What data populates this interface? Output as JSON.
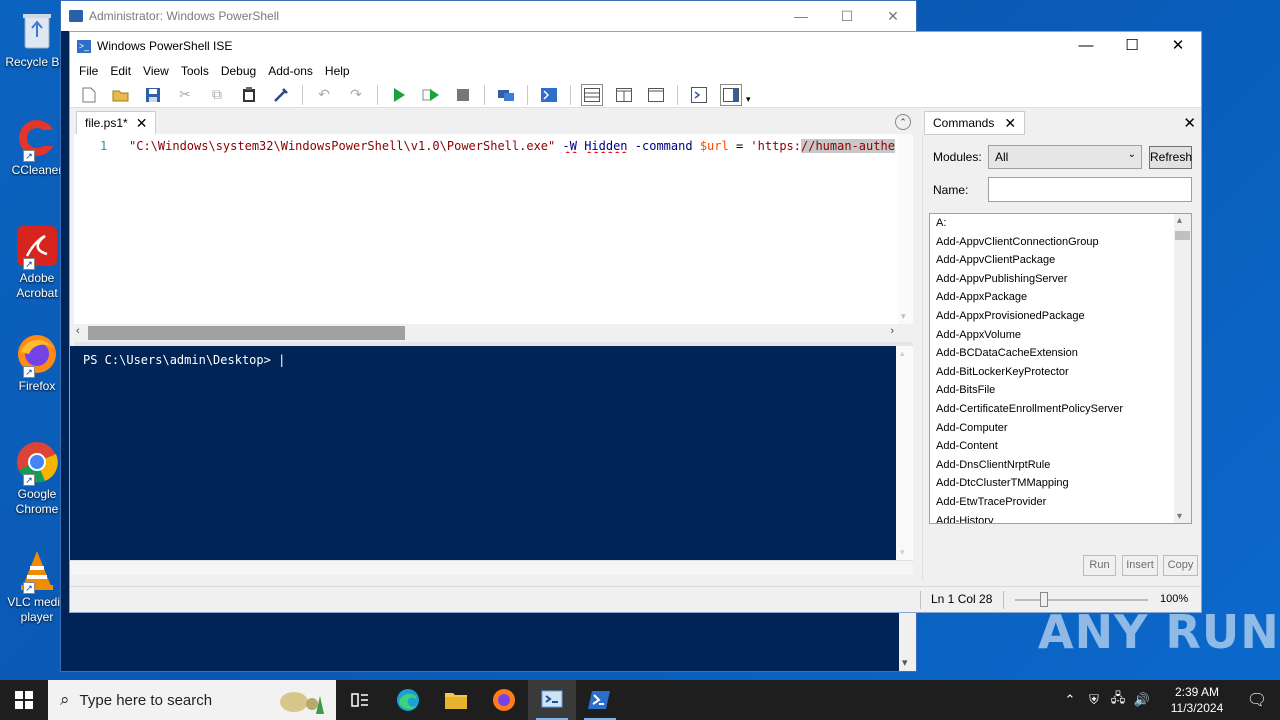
{
  "desktop": {
    "icons": [
      {
        "name": "recycle-bin",
        "label": "Recycle Bin"
      },
      {
        "name": "ccleaner",
        "label": "CCleaner"
      },
      {
        "name": "adobe-acrobat",
        "label": "Adobe Acrobat"
      },
      {
        "name": "firefox",
        "label": "Firefox"
      },
      {
        "name": "google-chrome",
        "label": "Google Chrome"
      },
      {
        "name": "vlc",
        "label": "VLC media player"
      }
    ]
  },
  "bg_window": {
    "title": "Administrator: Windows PowerShell"
  },
  "ise": {
    "title": "Windows PowerShell ISE",
    "menu": [
      "File",
      "Edit",
      "View",
      "Tools",
      "Debug",
      "Add-ons",
      "Help"
    ],
    "file_tab": "file.ps1*",
    "line_number": "1",
    "code": {
      "path": "\"C:\\Windows\\system32\\WindowsPowerShell\\v1.0\\PowerShell.exe\"",
      "w_param": "-W",
      "hidden": "Hidden",
      "command_param": "-command",
      "var": "$url",
      "eq": "=",
      "url_start": "'https:",
      "url_selected": "//human-authe"
    },
    "console_prompt": "PS C:\\Users\\admin\\Desktop> |"
  },
  "commands": {
    "tab_label": "Commands",
    "modules_label": "Modules:",
    "modules_value": "All",
    "refresh_label": "Refresh",
    "name_label": "Name:",
    "name_value": "",
    "items": [
      "A:",
      "Add-AppvClientConnectionGroup",
      "Add-AppvClientPackage",
      "Add-AppvPublishingServer",
      "Add-AppxPackage",
      "Add-AppxProvisionedPackage",
      "Add-AppxVolume",
      "Add-BCDataCacheExtension",
      "Add-BitLockerKeyProtector",
      "Add-BitsFile",
      "Add-CertificateEnrollmentPolicyServer",
      "Add-Computer",
      "Add-Content",
      "Add-DnsClientNrptRule",
      "Add-DtcClusterTMMapping",
      "Add-EtwTraceProvider",
      "Add-History"
    ],
    "run_label": "Run",
    "insert_label": "Insert",
    "copy_label": "Copy"
  },
  "status": {
    "position": "Ln 1  Col 28",
    "zoom": "100%"
  },
  "taskbar": {
    "search_placeholder": "Type here to search",
    "time": "2:39 AM",
    "date": "11/3/2024"
  },
  "watermark": "ANY RUN"
}
